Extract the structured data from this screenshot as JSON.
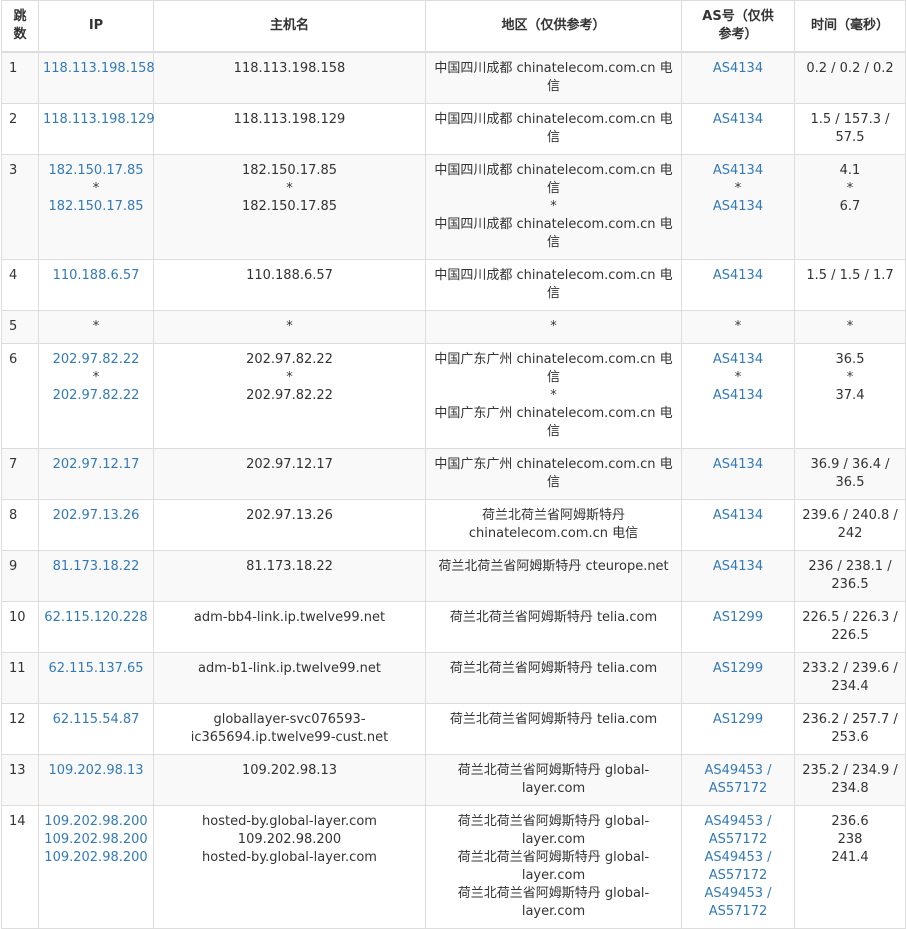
{
  "headers": {
    "hop": "跳数",
    "ip": "IP",
    "host": "主机名",
    "region": "地区（仅供参考）",
    "as": "AS号（仅供参考）",
    "time": "时间（毫秒）"
  },
  "colors": {
    "link": "#337ab7",
    "text": "#333333",
    "stripe": "#f9f9f9",
    "border": "#dddddd"
  },
  "rows": [
    {
      "hop": "1",
      "ip": [
        "118.113.198.158"
      ],
      "host": [
        "118.113.198.158"
      ],
      "region": [
        "中国四川成都 chinatelecom.com.cn 电信"
      ],
      "as": [
        "AS4134"
      ],
      "time": [
        "0.2 / 0.2 / 0.2"
      ]
    },
    {
      "hop": "2",
      "ip": [
        "118.113.198.129"
      ],
      "host": [
        "118.113.198.129"
      ],
      "region": [
        "中国四川成都 chinatelecom.com.cn 电信"
      ],
      "as": [
        "AS4134"
      ],
      "time": [
        "1.5 / 157.3 /",
        "57.5"
      ]
    },
    {
      "hop": "3",
      "ip": [
        "182.150.17.85",
        "*",
        "182.150.17.85"
      ],
      "host": [
        "182.150.17.85",
        "*",
        "182.150.17.85"
      ],
      "region": [
        "中国四川成都 chinatelecom.com.cn 电信",
        "*",
        "中国四川成都 chinatelecom.com.cn 电信"
      ],
      "as": [
        "AS4134",
        "*",
        "AS4134"
      ],
      "time": [
        "4.1",
        "*",
        "6.7"
      ]
    },
    {
      "hop": "4",
      "ip": [
        "110.188.6.57"
      ],
      "host": [
        "110.188.6.57"
      ],
      "region": [
        "中国四川成都 chinatelecom.com.cn 电信"
      ],
      "as": [
        "AS4134"
      ],
      "time": [
        "1.5 / 1.5 / 1.7"
      ]
    },
    {
      "hop": "5",
      "ip": [
        "*"
      ],
      "host": [
        "*"
      ],
      "region": [
        "*"
      ],
      "as": [
        "*"
      ],
      "time": [
        "*"
      ]
    },
    {
      "hop": "6",
      "ip": [
        "202.97.82.22",
        "*",
        "202.97.82.22"
      ],
      "host": [
        "202.97.82.22",
        "*",
        "202.97.82.22"
      ],
      "region": [
        "中国广东广州 chinatelecom.com.cn 电信",
        "*",
        "中国广东广州 chinatelecom.com.cn 电信"
      ],
      "as": [
        "AS4134",
        "*",
        "AS4134"
      ],
      "time": [
        "36.5",
        "*",
        "37.4"
      ]
    },
    {
      "hop": "7",
      "ip": [
        "202.97.12.17"
      ],
      "host": [
        "202.97.12.17"
      ],
      "region": [
        "中国广东广州 chinatelecom.com.cn 电信"
      ],
      "as": [
        "AS4134"
      ],
      "time": [
        "36.9 / 36.4 /",
        "36.5"
      ]
    },
    {
      "hop": "8",
      "ip": [
        "202.97.13.26"
      ],
      "host": [
        "202.97.13.26"
      ],
      "region": [
        "荷兰北荷兰省阿姆斯特丹",
        "chinatelecom.com.cn 电信"
      ],
      "as": [
        "AS4134"
      ],
      "time": [
        "239.6 / 240.8 /",
        "242"
      ]
    },
    {
      "hop": "9",
      "ip": [
        "81.173.18.22"
      ],
      "host": [
        "81.173.18.22"
      ],
      "region": [
        "荷兰北荷兰省阿姆斯特丹 cteurope.net"
      ],
      "as": [
        "AS4134"
      ],
      "time": [
        "236 / 238.1 /",
        "236.5"
      ]
    },
    {
      "hop": "10",
      "ip": [
        "62.115.120.228"
      ],
      "host": [
        "adm-bb4-link.ip.twelve99.net"
      ],
      "region": [
        "荷兰北荷兰省阿姆斯特丹 telia.com"
      ],
      "as": [
        "AS1299"
      ],
      "time": [
        "226.5 / 226.3 /",
        "226.5"
      ]
    },
    {
      "hop": "11",
      "ip": [
        "62.115.137.65"
      ],
      "host": [
        "adm-b1-link.ip.twelve99.net"
      ],
      "region": [
        "荷兰北荷兰省阿姆斯特丹 telia.com"
      ],
      "as": [
        "AS1299"
      ],
      "time": [
        "233.2 / 239.6 /",
        "234.4"
      ]
    },
    {
      "hop": "12",
      "ip": [
        "62.115.54.87"
      ],
      "host": [
        "globallayer-svc076593-",
        "ic365694.ip.twelve99-cust.net"
      ],
      "region": [
        "荷兰北荷兰省阿姆斯特丹 telia.com"
      ],
      "as": [
        "AS1299"
      ],
      "time": [
        "236.2 / 257.7 /",
        "253.6"
      ]
    },
    {
      "hop": "13",
      "ip": [
        "109.202.98.13"
      ],
      "host": [
        "109.202.98.13"
      ],
      "region": [
        "荷兰北荷兰省阿姆斯特丹 global-",
        "layer.com"
      ],
      "as": [
        "AS49453 /",
        "AS57172"
      ],
      "time": [
        "235.2 / 234.9 /",
        "234.8"
      ]
    },
    {
      "hop": "14",
      "ip": [
        "109.202.98.200",
        "109.202.98.200",
        "109.202.98.200"
      ],
      "host": [
        "hosted-by.global-layer.com",
        "109.202.98.200",
        "hosted-by.global-layer.com"
      ],
      "region": [
        "荷兰北荷兰省阿姆斯特丹 global-",
        "layer.com",
        "荷兰北荷兰省阿姆斯特丹 global-",
        "layer.com",
        "荷兰北荷兰省阿姆斯特丹 global-",
        "layer.com"
      ],
      "as": [
        "AS49453 /",
        "AS57172",
        "AS49453 /",
        "AS57172",
        "AS49453 /",
        "AS57172"
      ],
      "time": [
        "236.6",
        "238",
        "241.4"
      ]
    }
  ]
}
